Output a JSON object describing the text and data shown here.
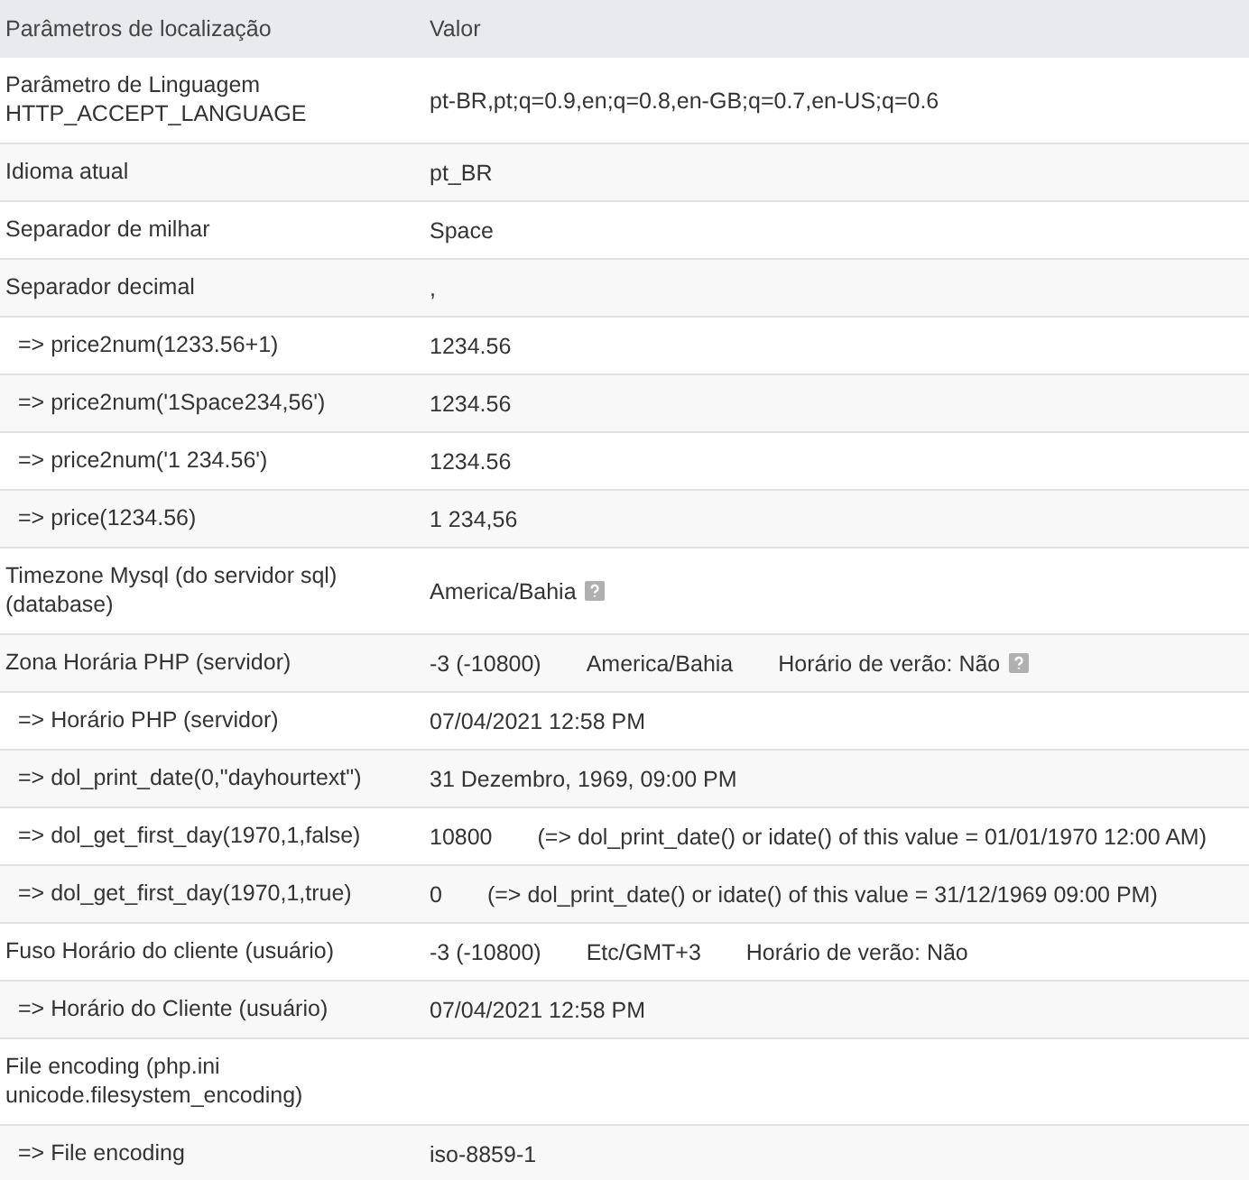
{
  "table": {
    "columns": [
      "Parâmetros de localização",
      "Valor"
    ],
    "rows": [
      {
        "kind": "main",
        "parameter": "Parâmetro de Linguagem HTTP_ACCEPT_LANGUAGE",
        "values": [
          {
            "text": "pt-BR,pt;q=0.9,en;q=0.8,en-GB;q=0.7,en-US;q=0.6",
            "help": false
          }
        ]
      },
      {
        "kind": "main",
        "parameter": "Idioma atual",
        "values": [
          {
            "text": "pt_BR",
            "help": false
          }
        ]
      },
      {
        "kind": "main",
        "parameter": "Separador de milhar",
        "values": [
          {
            "text": "Space",
            "help": false
          }
        ]
      },
      {
        "kind": "main",
        "parameter": "Separador decimal",
        "values": [
          {
            "text": ",",
            "help": false
          }
        ]
      },
      {
        "kind": "sub",
        "parameter": "=> price2num(1233.56+1)",
        "values": [
          {
            "text": "1234.56",
            "help": false
          }
        ]
      },
      {
        "kind": "sub",
        "parameter": "=> price2num('1Space234,56')",
        "values": [
          {
            "text": "1234.56",
            "help": false
          }
        ]
      },
      {
        "kind": "sub",
        "parameter": "=> price2num('1 234.56')",
        "values": [
          {
            "text": "1234.56",
            "help": false
          }
        ]
      },
      {
        "kind": "sub",
        "parameter": "=> price(1234.56)",
        "values": [
          {
            "text": "1 234,56",
            "help": false
          }
        ]
      },
      {
        "kind": "main",
        "parameter": "Timezone Mysql (do servidor sql) (database)",
        "values": [
          {
            "text": "America/Bahia",
            "help": true
          }
        ]
      },
      {
        "kind": "main",
        "parameter": "Zona Horária PHP (servidor)",
        "values": [
          {
            "text": "-3 (-10800)",
            "help": false
          },
          {
            "text": "America/Bahia",
            "help": false
          },
          {
            "text": "Horário de verão: Não",
            "help": true
          }
        ]
      },
      {
        "kind": "sub",
        "parameter": "=> Horário PHP (servidor)",
        "values": [
          {
            "text": "07/04/2021 12:58 PM",
            "help": false
          }
        ]
      },
      {
        "kind": "sub",
        "parameter": "=> dol_print_date(0,\"dayhourtext\")",
        "values": [
          {
            "text": "31 Dezembro, 1969, 09:00 PM",
            "help": false
          }
        ]
      },
      {
        "kind": "sub",
        "parameter": "=> dol_get_first_day(1970,1,false)",
        "values": [
          {
            "text": "10800",
            "help": false
          },
          {
            "text": "(=> dol_print_date() or idate() of this value = 01/01/1970 12:00 AM)",
            "help": false
          }
        ]
      },
      {
        "kind": "sub",
        "parameter": "=> dol_get_first_day(1970,1,true)",
        "values": [
          {
            "text": "0",
            "help": false
          },
          {
            "text": "(=> dol_print_date() or idate() of this value = 31/12/1969 09:00 PM)",
            "help": false
          }
        ]
      },
      {
        "kind": "main",
        "parameter": "Fuso Horário do cliente (usuário)",
        "values": [
          {
            "text": "-3 (-10800)",
            "help": false
          },
          {
            "text": "Etc/GMT+3",
            "help": false
          },
          {
            "text": "Horário de verão: Não",
            "help": false
          }
        ]
      },
      {
        "kind": "sub",
        "parameter": "=> Horário do Cliente (usuário)",
        "values": [
          {
            "text": "07/04/2021 12:58 PM",
            "help": false
          }
        ]
      },
      {
        "kind": "main",
        "parameter": "File encoding (php.ini unicode.filesystem_encoding)",
        "values": []
      },
      {
        "kind": "sub",
        "parameter": "=> File encoding",
        "values": [
          {
            "text": "iso-8859-1",
            "help": false
          }
        ]
      }
    ]
  }
}
